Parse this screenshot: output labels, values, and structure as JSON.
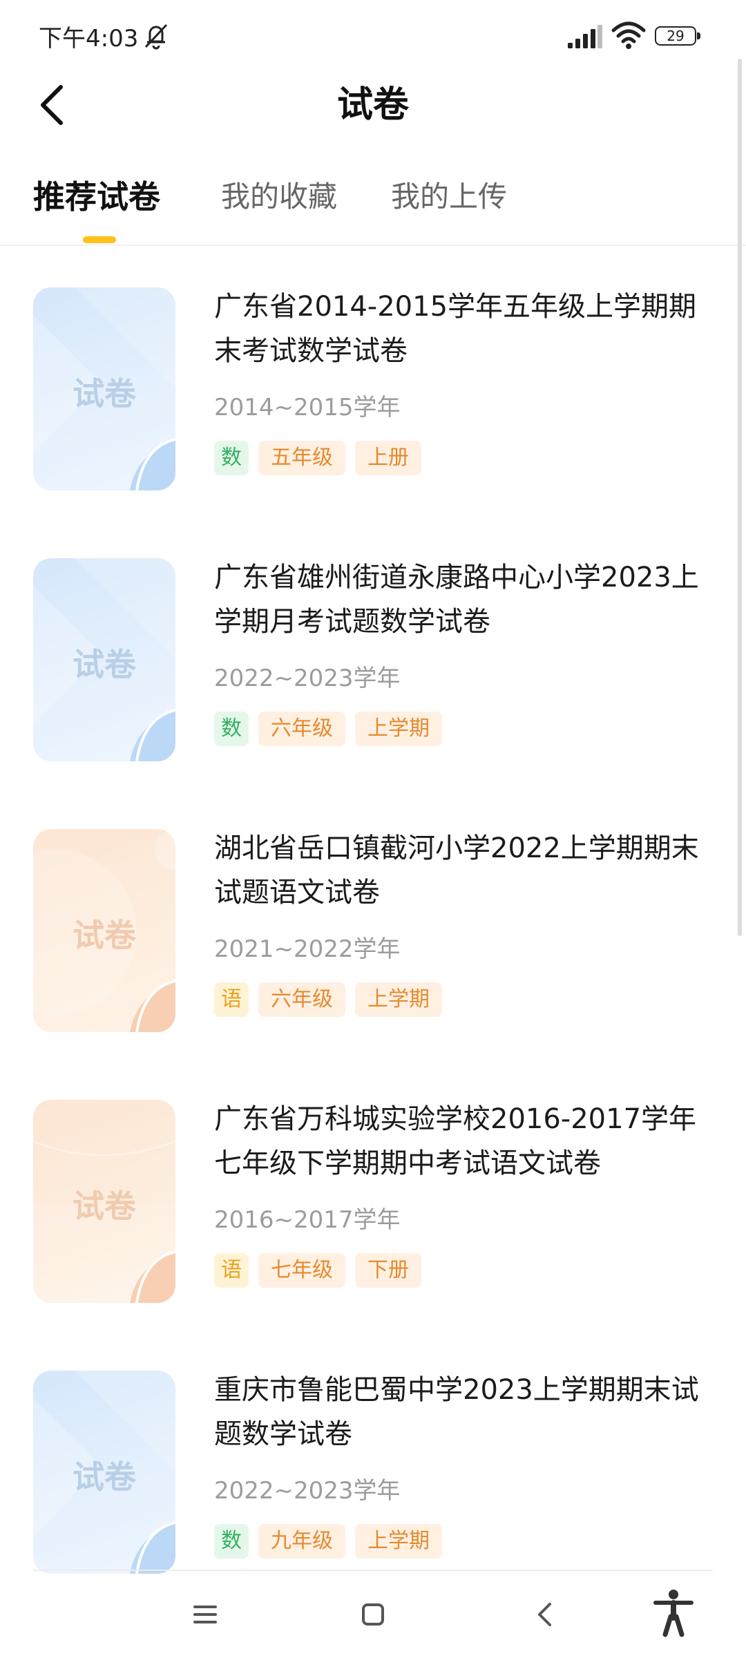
{
  "status_bar": {
    "time": "下午4:03",
    "battery": "29"
  },
  "header": {
    "title": "试卷"
  },
  "tabs": [
    {
      "label": "推荐试卷",
      "active": true
    },
    {
      "label": "我的收藏",
      "active": false
    },
    {
      "label": "我的上传",
      "active": false
    }
  ],
  "papers": [
    {
      "title": "广东省2014-2015学年五年级上学期期末考试数学试卷",
      "year": "2014~2015学年",
      "subject": "数",
      "grade": "五年级",
      "term": "上册",
      "thumb_label": "试卷",
      "theme": "blue"
    },
    {
      "title": "广东省雄州街道永康路中心小学2023上学期月考试题数学试卷",
      "year": "2022~2023学年",
      "subject": "数",
      "grade": "六年级",
      "term": "上学期",
      "thumb_label": "试卷",
      "theme": "blue"
    },
    {
      "title": "湖北省岳口镇截河小学2022上学期期末试题语文试卷",
      "year": "2021~2022学年",
      "subject": "语",
      "grade": "六年级",
      "term": "上学期",
      "thumb_label": "试卷",
      "theme": "orange"
    },
    {
      "title": "广东省万科城实验学校2016-2017学年七年级下学期期中考试语文试卷",
      "year": "2016~2017学年",
      "subject": "语",
      "grade": "七年级",
      "term": "下册",
      "thumb_label": "试卷",
      "theme": "orange"
    },
    {
      "title": "重庆市鲁能巴蜀中学2023上学期期末试题数学试卷",
      "year": "2022~2023学年",
      "subject": "数",
      "grade": "九年级",
      "term": "上学期",
      "thumb_label": "试卷",
      "theme": "blue"
    }
  ],
  "icons": {
    "back": "chevron-left-icon",
    "mute": "bell-off-icon",
    "signal": "signal-icon",
    "wifi": "wifi-icon",
    "nav_menu": "menu-icon",
    "nav_home": "square-home-icon",
    "nav_back": "chevron-back-icon",
    "accessibility": "accessibility-icon"
  },
  "colors": {
    "accent": "#ffc21c",
    "math_tag": "#33b062",
    "chinese_tag": "#e8a21b",
    "info_tag": "#e58a2e"
  }
}
